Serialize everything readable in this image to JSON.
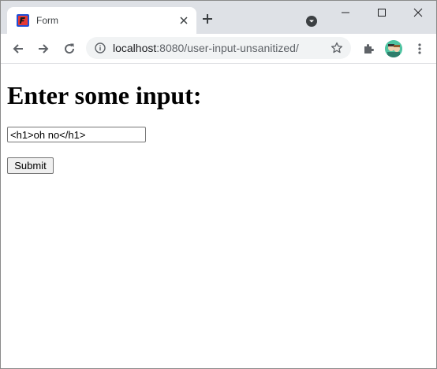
{
  "browser": {
    "tab": {
      "title": "Form",
      "favicon": "form-app-favicon-icon"
    },
    "address_bar": {
      "host": "localhost",
      "path": ":8080/user-input-unsanitized/"
    },
    "icons": {
      "back": "arrow-left-icon",
      "forward": "arrow-right-icon",
      "reload": "reload-icon",
      "info": "info-icon",
      "bookmark": "star-icon",
      "extensions": "puzzle-icon",
      "menu": "kebab-menu-icon",
      "new_tab": "plus-icon",
      "tab_search": "tab-search-icon",
      "minimize": "minimize-icon",
      "maximize": "maximize-icon",
      "close": "close-icon"
    },
    "colors": {
      "tabstrip_bg": "#dee1e6",
      "omnibox_bg": "#f1f3f4",
      "favicon_bg": "#1f4fd6",
      "favicon_accent": "#e53935"
    }
  },
  "page": {
    "heading": "Enter some input:",
    "input": {
      "value": "<h1>oh no</h1>",
      "placeholder": ""
    },
    "submit_label": "Submit"
  }
}
